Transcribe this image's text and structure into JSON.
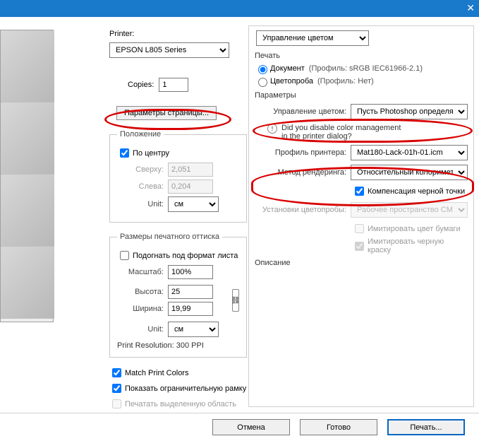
{
  "titlebar": {
    "close": "✕"
  },
  "mid": {
    "printer_label": "Printer:",
    "printer_value": "EPSON L805 Series",
    "copies_label": "Copies:",
    "copies_value": "1",
    "page_params_btn": "Параметры страницы...",
    "position": {
      "legend": "Положение",
      "center": "По центру",
      "top_label": "Сверху:",
      "top_value": "2,051",
      "left_label": "Слева:",
      "left_value": "0,204",
      "unit_label": "Unit:",
      "unit_value": "см"
    },
    "printsize": {
      "legend": "Размеры печатного оттиска",
      "fit": "Подогнать под формат листа",
      "scale_label": "Масштаб:",
      "scale_value": "100%",
      "height_label": "Высота:",
      "height_value": "25",
      "width_label": "Ширина:",
      "width_value": "19,99",
      "unit_label": "Unit:",
      "unit_value": "см",
      "res_line": "Print Resolution: 300 PPI"
    },
    "match_colors": "Match Print Colors",
    "show_bbox": "Показать ограничительную рамку",
    "print_selection": "Печатать выделенную область"
  },
  "right": {
    "top_select": "Управление цветом",
    "print_title": "Печать",
    "doc_label": "Документ",
    "doc_profile": "(Профиль: sRGB IEC61966-2.1)",
    "proof_label": "Цветопроба",
    "proof_profile": "(Профиль: Нет)",
    "params_title": "Параметры",
    "color_mgmt_label": "Управление цветом:",
    "color_mgmt_value": "Пусть Photoshop определяет ...",
    "warn_text1": "Did you disable color management",
    "warn_text2": "in the printer dialog?",
    "printer_profile_label": "Профиль принтера:",
    "printer_profile_value": "Mat180-Lack-01h-01.icm",
    "render_label": "Метод рендеринга:",
    "render_value": "Относительный колориметр...",
    "bpc": "Компенсация черной точки",
    "proof_setup_label": "Установки цветопробы:",
    "proof_setup_value": "Рабочее пространство CMYK",
    "sim_paper": "Имитировать цвет бумаги",
    "sim_black": "Имитировать черную краску",
    "desc_title": "Описание"
  },
  "buttons": {
    "cancel": "Отмена",
    "done": "Готово",
    "print": "Печать..."
  }
}
